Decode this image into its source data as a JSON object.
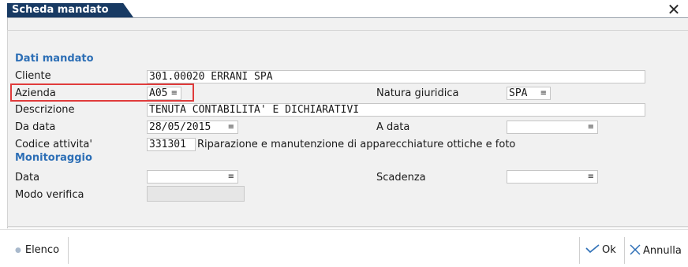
{
  "window": {
    "title": "Scheda mandato",
    "close_icon": "close-icon"
  },
  "sections": {
    "mandato": "Dati mandato",
    "monitoraggio": "Monitoraggio"
  },
  "fields": {
    "cliente": {
      "label": "Cliente",
      "value": "301.00020 ERRANI SPA"
    },
    "azienda": {
      "label": "Azienda",
      "value": "A05"
    },
    "natura_giuridica": {
      "label": "Natura giuridica",
      "value": "SPA"
    },
    "descrizione": {
      "label": "Descrizione",
      "value": "TENUTA CONTABILITA' E DICHIARATIVI"
    },
    "da_data": {
      "label": "Da data",
      "value": "28/05/2015"
    },
    "a_data": {
      "label": "A data",
      "value": ""
    },
    "codice_attivita": {
      "label": "Codice attivita'",
      "value": "331301",
      "description": "Riparazione e manutenzione di apparecchiature ottiche e foto"
    },
    "data": {
      "label": "Data",
      "value": ""
    },
    "scadenza": {
      "label": "Scadenza",
      "value": ""
    },
    "modo_verifica": {
      "label": "Modo verifica",
      "value": ""
    }
  },
  "combo_glyph": "≡",
  "footer": {
    "elenco": "Elenco",
    "ok": "Ok",
    "annulla": "Annulla"
  },
  "colors": {
    "title_bg": "#183a63",
    "section": "#2d6fb6",
    "highlight": "#e03b3b",
    "ok_icon": "#2d6fb6"
  }
}
